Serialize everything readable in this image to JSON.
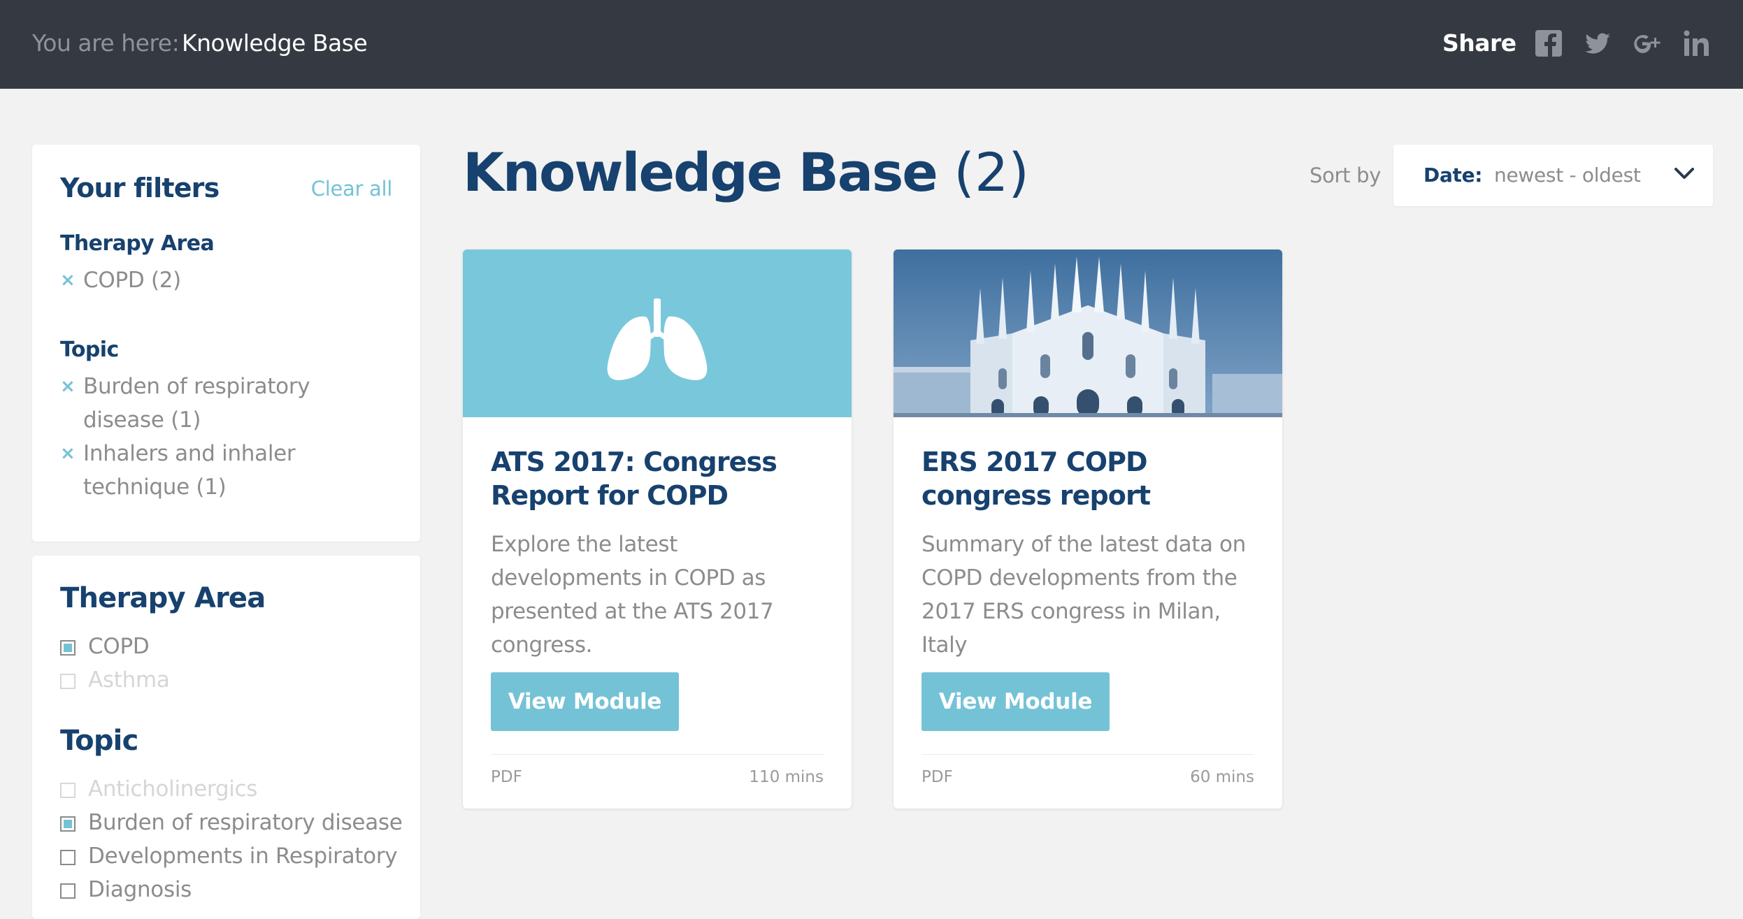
{
  "topbar": {
    "breadcrumb_label": "You are here:",
    "breadcrumb_current": "Knowledge Base",
    "share_label": "Share",
    "social": [
      "facebook-icon",
      "twitter-icon",
      "google-plus-icon",
      "linkedin-icon"
    ]
  },
  "active_filters": {
    "title": "Your filters",
    "clear_label": "Clear all",
    "groups": [
      {
        "label": "Therapy Area",
        "chips": [
          "COPD (2)"
        ]
      },
      {
        "label": "Topic",
        "chips": [
          "Burden of respiratory disease (1)",
          "Inhalers and inhaler technique (1)"
        ]
      }
    ],
    "remove_glyph": "×"
  },
  "filter_list": {
    "groups": [
      {
        "label": "Therapy Area",
        "items": [
          {
            "label": "COPD",
            "checked": true,
            "enabled": true
          },
          {
            "label": "Asthma",
            "checked": false,
            "enabled": false
          }
        ]
      },
      {
        "label": "Topic",
        "items": [
          {
            "label": "Anticholinergics",
            "checked": false,
            "enabled": false
          },
          {
            "label": "Burden of respiratory disease",
            "checked": true,
            "enabled": true
          },
          {
            "label": "Developments in Respiratory",
            "checked": false,
            "enabled": true
          },
          {
            "label": "Diagnosis",
            "checked": false,
            "enabled": true
          }
        ]
      }
    ]
  },
  "main": {
    "title": "Knowledge Base",
    "count": "(2)",
    "sort_label": "Sort by",
    "sort_key": "Date:",
    "sort_value": "newest - oldest"
  },
  "cards": [
    {
      "image_icon": "lungs-icon",
      "title": "ATS 2017: Congress Report for COPD",
      "description": "Explore the latest developments in COPD as presented at the ATS 2017 congress.",
      "button_label": "View Module",
      "type": "PDF",
      "duration": "110 mins"
    },
    {
      "image_icon": "cathedral-photo",
      "title": "ERS 2017 COPD congress report",
      "description": "Summary of the latest data on COPD developments from the 2017 ERS congress in Milan, Italy",
      "button_label": "View Module",
      "type": "PDF",
      "duration": "60 mins"
    }
  ],
  "colors": {
    "topbar": "#353a42",
    "navy": "#17416e",
    "accent": "#74c2d6",
    "muted_text": "#8c8c8c",
    "page_bg": "#f2f2f2"
  }
}
